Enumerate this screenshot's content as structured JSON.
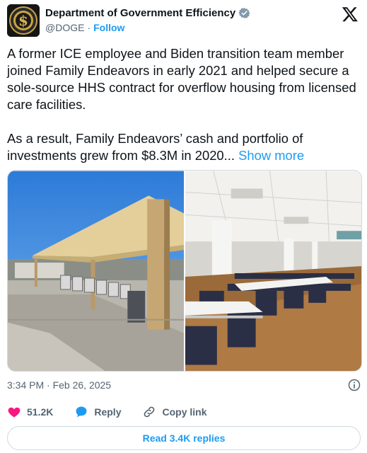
{
  "author": {
    "display_name": "Department of Government Efficiency",
    "handle": "@DOGE",
    "separator": "·",
    "follow_label": "Follow",
    "avatar_icon": "dollar-seal-icon",
    "verified_icon": "verified-badge-icon"
  },
  "tweet": {
    "paragraph_1": "A former ICE employee and Biden transition team member joined Family Endeavors in early 2021 and helped secure a sole-source HHS contract for overflow housing from licensed care facilities.",
    "paragraph_2": "As a result, Family Endeavors’ cash and portfolio of investments grew from $8.3M in 2020...",
    "show_more_label": "Show more"
  },
  "media": {
    "left_image": "outdoor-shade-canopy-photo",
    "right_image": "dining-hall-interior-photo"
  },
  "meta": {
    "timestamp": "3:34 PM · Feb 26, 2025"
  },
  "actions": {
    "like_count": "51.2K",
    "reply_label": "Reply",
    "copy_link_label": "Copy link"
  },
  "footer": {
    "read_replies_label": "Read 3.4K replies"
  },
  "colors": {
    "accent": "#1d9bf0",
    "like": "#f91880",
    "muted": "#536471",
    "text": "#0f1419"
  }
}
